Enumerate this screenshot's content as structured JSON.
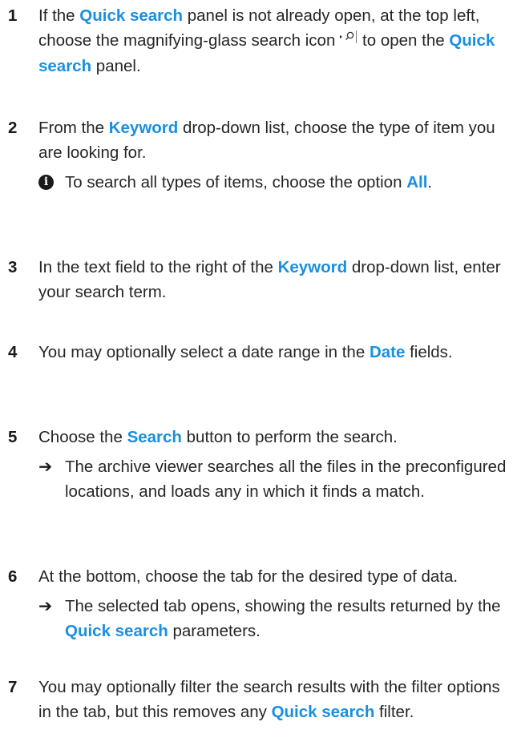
{
  "steps": [
    {
      "num": "1",
      "parts": [
        "If the ",
        "Quick search",
        " panel is not already open, at the top left, choose the magnifying-glass search icon",
        " to open the ",
        "Quick search",
        " panel."
      ]
    },
    {
      "num": "2",
      "parts": [
        "From the ",
        "Keyword",
        " drop-down list, choose the type of item you are looking for."
      ],
      "note_parts": [
        "To search all types of items, choose the option ",
        "All",
        "."
      ]
    },
    {
      "num": "3",
      "parts": [
        "In the text field to the right of the ",
        "Keyword",
        " drop-down list, enter your search term."
      ]
    },
    {
      "num": "4",
      "parts": [
        "You may optionally select a date range in the ",
        "Date",
        " fields."
      ]
    },
    {
      "num": "5",
      "parts": [
        "Choose the ",
        "Search",
        " button to perform the search."
      ],
      "result_text": "The archive viewer searches all the files in the preconfigured locations, and loads any in which it finds a match."
    },
    {
      "num": "6",
      "parts": [
        "At the bottom, choose the tab for the desired type of data."
      ],
      "result_parts": [
        "The selected tab opens, showing the results returned by the ",
        "Quick search",
        " parameters."
      ]
    },
    {
      "num": "7",
      "parts": [
        "You may optionally filter the search results with the filter options in the tab, but this removes any ",
        "Quick search",
        " filter."
      ]
    }
  ],
  "glyphs": {
    "result_arrow": "➔",
    "info": "i"
  },
  "icons": [
    "search-icon",
    "info-icon",
    "result-arrow-icon"
  ],
  "colors": {
    "keyword": "#1a8fe0",
    "text": "#262626"
  }
}
